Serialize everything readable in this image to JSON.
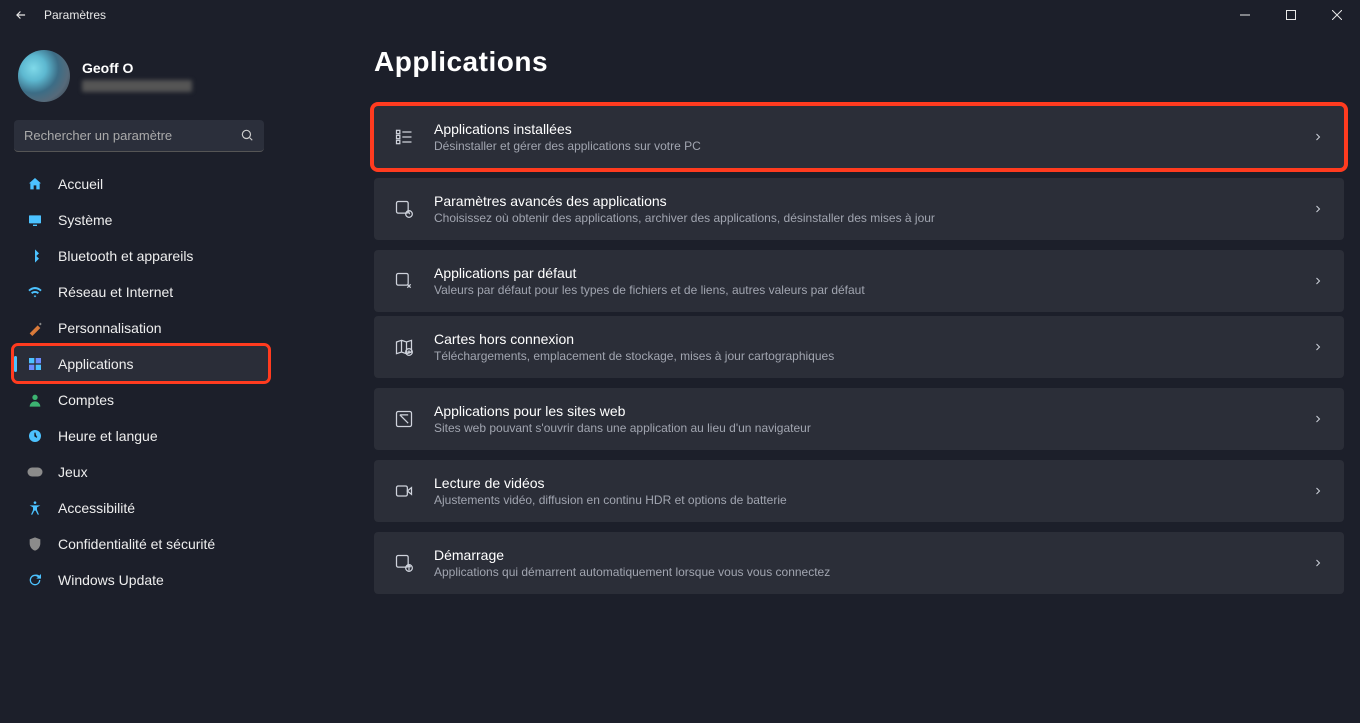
{
  "window": {
    "title": "Paramètres"
  },
  "profile": {
    "name": "Geoff O"
  },
  "search": {
    "placeholder": "Rechercher un paramètre"
  },
  "nav": {
    "home": "Accueil",
    "system": "Système",
    "bluetooth": "Bluetooth et appareils",
    "network": "Réseau et Internet",
    "personalization": "Personnalisation",
    "apps": "Applications",
    "accounts": "Comptes",
    "time": "Heure et langue",
    "gaming": "Jeux",
    "accessibility": "Accessibilité",
    "privacy": "Confidentialité et sécurité",
    "update": "Windows Update"
  },
  "page": {
    "title": "Applications",
    "cards": {
      "installed": {
        "title": "Applications installées",
        "desc": "Désinstaller et gérer des applications sur votre PC"
      },
      "advanced": {
        "title": "Paramètres avancés des applications",
        "desc": "Choisissez où obtenir des applications, archiver des applications, désinstaller des mises à jour"
      },
      "defaults": {
        "title": "Applications par défaut",
        "desc": "Valeurs par défaut pour les types de fichiers et de liens, autres valeurs par défaut"
      },
      "maps": {
        "title": "Cartes hors connexion",
        "desc": "Téléchargements, emplacement de stockage, mises à jour cartographiques"
      },
      "websites": {
        "title": "Applications pour les sites web",
        "desc": "Sites web pouvant s'ouvrir dans une application au lieu d'un navigateur"
      },
      "video": {
        "title": "Lecture de vidéos",
        "desc": "Ajustements vidéo, diffusion en continu HDR et options de batterie"
      },
      "startup": {
        "title": "Démarrage",
        "desc": "Applications qui démarrent automatiquement lorsque vous vous connectez"
      }
    }
  }
}
